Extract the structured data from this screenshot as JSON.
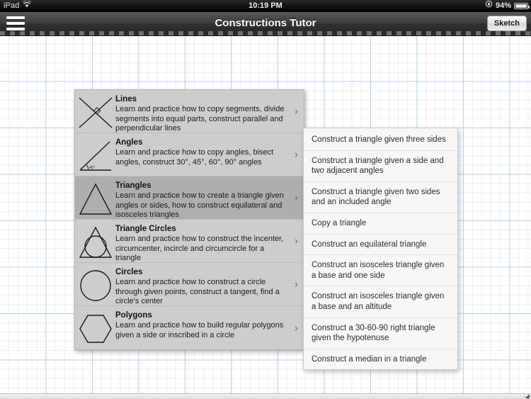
{
  "status_bar": {
    "carrier": "iPad",
    "wifi_icon": "wifi-icon",
    "time": "10:19 PM",
    "rotation_lock_icon": "rotation-lock-icon",
    "battery_percent": "94%",
    "battery_icon": "battery-icon",
    "battery_level": 94
  },
  "nav_bar": {
    "menu_icon": "hamburger-menu-icon",
    "title": "Constructions Tutor",
    "sketch_label": "Sketch"
  },
  "categories": [
    {
      "title": "Lines",
      "description": "Learn and practice how to copy segments, divide segments into equal parts, construct parallel and perpendicular lines",
      "icon": "crossing-lines-icon",
      "selected": false,
      "chevron": "›"
    },
    {
      "title": "Angles",
      "description": "Learn and practice how to copy angles, bisect angles, construct 30°, 45°, 60°, 90° angles",
      "icon": "angle-45-icon",
      "selected": false,
      "chevron": "›"
    },
    {
      "title": "Triangles",
      "description": "Learn and practice how to create a triangle given angles or sides, how to construct equilateral and isosceles triangles",
      "icon": "triangle-icon",
      "selected": true,
      "chevron": "›"
    },
    {
      "title": "Triangle Circles",
      "description": "Learn and practice how to construct the incenter, circumcenter, incircle and circumcircle for a triangle",
      "icon": "triangle-with-incircle-icon",
      "selected": false,
      "chevron": "›"
    },
    {
      "title": "Circles",
      "description": "Learn and practice how to construct a circle through given points, construct a tangent, find a circle's center",
      "icon": "circle-icon",
      "selected": false,
      "chevron": "›"
    },
    {
      "title": "Polygons",
      "description": "Learn and practice how to build regular polygons given a side or inscribed in a circle",
      "icon": "hexagon-icon",
      "selected": false,
      "chevron": "›"
    }
  ],
  "task_popover": {
    "items": [
      "Construct a triangle given three sides",
      "Construct a triangle given a side and two adjacent angles",
      "Construct a triangle given two sides and an included angle",
      "Copy a triangle",
      "Construct an equilateral triangle",
      "Construct an isosceles triangle given a base and one side",
      "Construct an isosceles triangle given a base and an altitude",
      "Construct a 30-60-90 right triangle given the hypotenuse",
      "Construct a median in a triangle"
    ]
  },
  "colors": {
    "navbar_dark": "#3d3d3d",
    "list_background": "#cdcdcd",
    "list_selected": "#aeaeae",
    "popover_background": "#f7f7f7",
    "grid_line": "#96b4d7",
    "canvas_background": "#ffffff"
  }
}
